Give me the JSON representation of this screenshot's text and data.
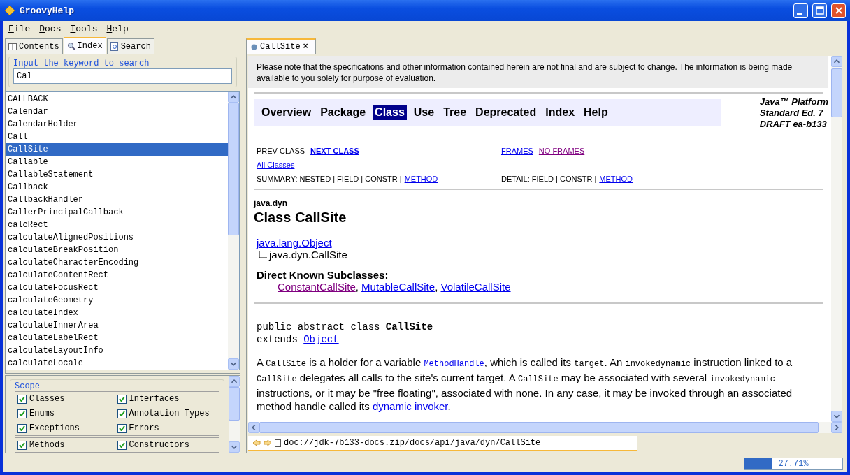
{
  "window": {
    "title": "GroovyHelp"
  },
  "menu": [
    "File",
    "Docs",
    "Tools",
    "Help"
  ],
  "left_tabs": [
    {
      "label": "Contents",
      "selected": false,
      "kind": "book"
    },
    {
      "label": "Index",
      "selected": true,
      "kind": "search"
    },
    {
      "label": "Search",
      "selected": false,
      "kind": "page"
    }
  ],
  "search": {
    "legend": "Input the keyword to search",
    "value": "Cal"
  },
  "index_items": [
    {
      "label": "CALLBACK",
      "selected": false
    },
    {
      "label": "Calendar",
      "selected": false
    },
    {
      "label": "CalendarHolder",
      "selected": false
    },
    {
      "label": "Call",
      "selected": false
    },
    {
      "label": "CallSite",
      "selected": true
    },
    {
      "label": "Callable",
      "selected": false
    },
    {
      "label": "CallableStatement",
      "selected": false
    },
    {
      "label": "Callback",
      "selected": false
    },
    {
      "label": "CallbackHandler",
      "selected": false
    },
    {
      "label": "CallerPrincipalCallback",
      "selected": false
    },
    {
      "label": "calcRect",
      "selected": false
    },
    {
      "label": "calculateAlignedPositions",
      "selected": false
    },
    {
      "label": "calculateBreakPosition",
      "selected": false
    },
    {
      "label": "calculateCharacterEncoding",
      "selected": false
    },
    {
      "label": "calculateContentRect",
      "selected": false
    },
    {
      "label": "calculateFocusRect",
      "selected": false
    },
    {
      "label": "calculateGeometry",
      "selected": false
    },
    {
      "label": "calculateIndex",
      "selected": false
    },
    {
      "label": "calculateInnerArea",
      "selected": false
    },
    {
      "label": "calculateLabelRect",
      "selected": false
    },
    {
      "label": "calculateLayoutInfo",
      "selected": false
    },
    {
      "label": "calculateLocale",
      "selected": false
    }
  ],
  "scope": {
    "legend": "Scope",
    "groups": [
      [
        {
          "label": "Classes",
          "checked": true
        },
        {
          "label": "Interfaces",
          "checked": true
        },
        {
          "label": "Enums",
          "checked": true
        },
        {
          "label": "Annotation Types",
          "checked": true
        },
        {
          "label": "Exceptions",
          "checked": true
        },
        {
          "label": "Errors",
          "checked": true
        }
      ],
      [
        {
          "label": "Methods",
          "checked": true
        },
        {
          "label": "Constructors",
          "checked": true
        }
      ]
    ]
  },
  "doc_tab": {
    "label": "CallSite",
    "close": "×",
    "selected": true
  },
  "doc": {
    "notice": "Please note that the specifications and other information contained herein are not final and are subject to change. The information is being made available to you solely for purpose of evaluation.",
    "nav": [
      {
        "label": "Overview",
        "selected": false
      },
      {
        "label": "Package",
        "selected": false
      },
      {
        "label": "Class",
        "selected": true
      },
      {
        "label": "Use",
        "selected": false
      },
      {
        "label": "Tree",
        "selected": false
      },
      {
        "label": "Deprecated",
        "selected": false
      },
      {
        "label": "Index",
        "selected": false
      },
      {
        "label": "Help",
        "selected": false
      }
    ],
    "platform": [
      "Java™ Platform",
      "Standard Ed. 7",
      "DRAFT ea-b133"
    ],
    "prev_class": "PREV CLASS",
    "next_class": "NEXT CLASS",
    "frames": [
      {
        "label": "FRAMES",
        "visited": false
      },
      {
        "label": "NO FRAMES",
        "visited": true
      }
    ],
    "all_classes": "All Classes",
    "summary": {
      "text": "SUMMARY: NESTED | FIELD | CONSTR |",
      "link": "METHOD"
    },
    "detail": {
      "text": "DETAIL: FIELD | CONSTR |",
      "link": "METHOD"
    },
    "package": "java.dyn",
    "title": "Class CallSite",
    "hierarchy": {
      "parent": "java.lang.Object",
      "child": "java.dyn.CallSite"
    },
    "subclasses": {
      "heading": "Direct Known Subclasses:",
      "separator": ",",
      "items": [
        {
          "label": "ConstantCallSite",
          "visited": true
        },
        {
          "label": "MutableCallSite",
          "visited": false
        },
        {
          "label": "VolatileCallSite",
          "visited": false
        }
      ]
    },
    "declaration": "public abstract class **CallSite**",
    "extends": {
      "text": "extends",
      "link": "Object"
    },
    "description": [
      {
        "kind": "text",
        "text": "A "
      },
      {
        "kind": "code",
        "text": "CallSite"
      },
      {
        "kind": "text",
        "text": " is a holder for a variable "
      },
      {
        "kind": "codelink",
        "text": "MethodHandle"
      },
      {
        "kind": "text",
        "text": ", which is called its "
      },
      {
        "kind": "code",
        "text": "target"
      },
      {
        "kind": "text",
        "text": ". An "
      },
      {
        "kind": "code",
        "text": "invokedynamic"
      },
      {
        "kind": "text",
        "text": " instruction linked to a "
      },
      {
        "kind": "code",
        "text": "CallSite"
      },
      {
        "kind": "text",
        "text": " delegates all calls to the site's current target. A "
      },
      {
        "kind": "code",
        "text": "CallSite"
      },
      {
        "kind": "text",
        "text": " may be associated with several "
      },
      {
        "kind": "code",
        "text": "invokedynamic"
      },
      {
        "kind": "text",
        "text": " instructions, or it may be \"free floating\", associated with none. In any case, it may be invoked through an associated method handle called its "
      },
      {
        "kind": "link",
        "text": "dynamic invoker"
      },
      {
        "kind": "text",
        "text": "."
      }
    ]
  },
  "address": "doc://jdk-7b133-docs.zip/docs/api/java/dyn/CallSite",
  "status": {
    "level": 0.2771,
    "reading": "27.71%"
  }
}
